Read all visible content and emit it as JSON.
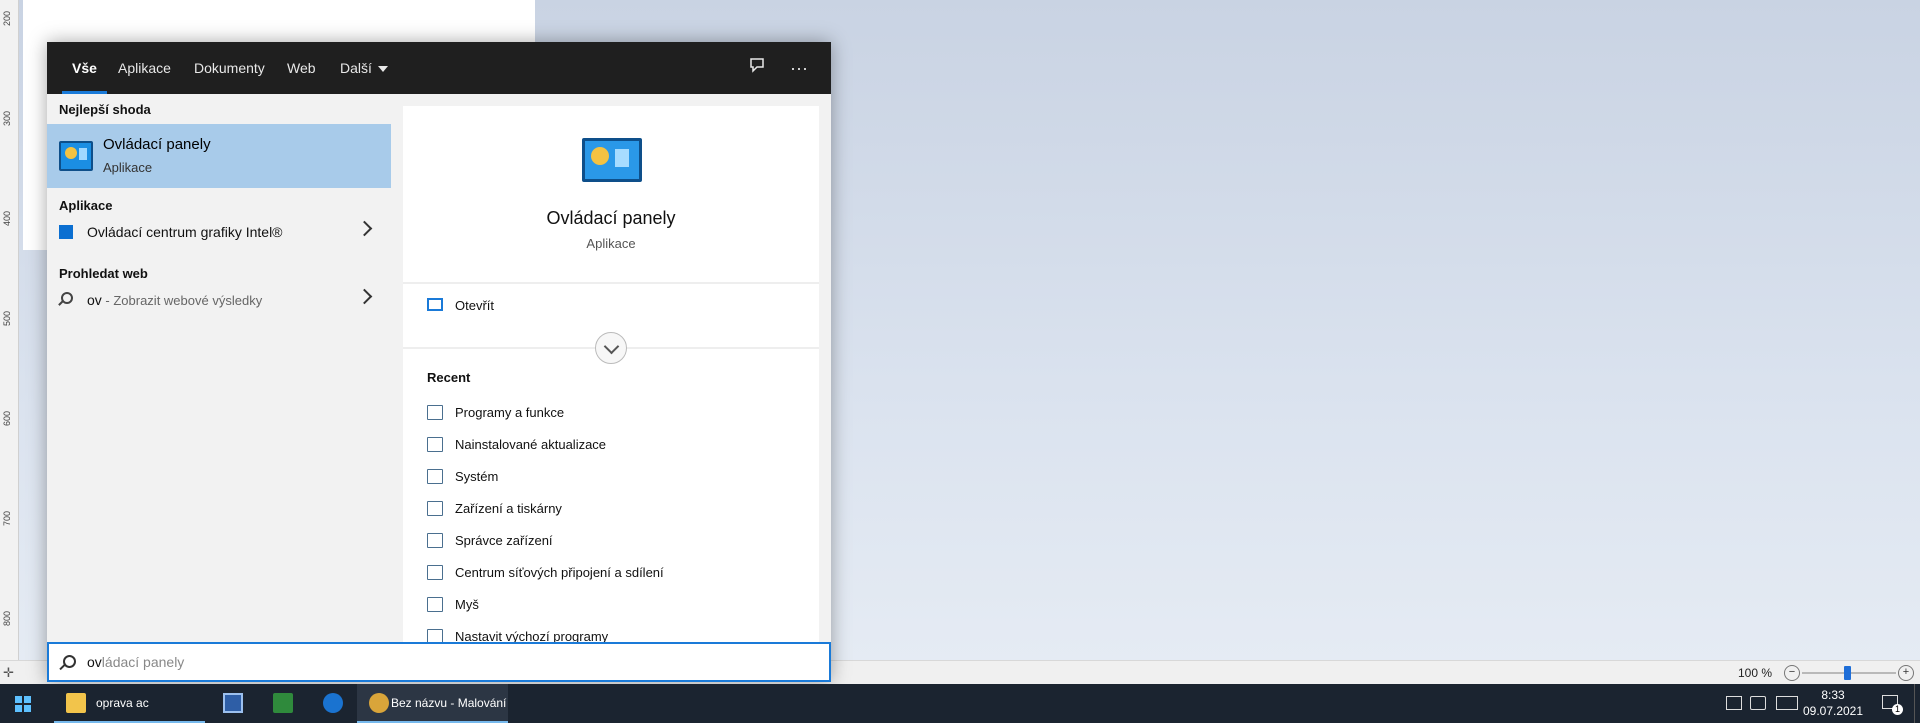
{
  "paint": {
    "ruler_ticks": [
      "200",
      "300",
      "400",
      "500",
      "600",
      "700",
      "800"
    ],
    "zoom_label": "100 %",
    "zoom_out": "−",
    "zoom_in": "+"
  },
  "search_menu": {
    "tabs": [
      "Vše",
      "Aplikace",
      "Dokumenty",
      "Web",
      "Další"
    ],
    "more_icon": "···",
    "feedback_icon": "feedback-icon",
    "best_match_label": "Nejlepší shoda",
    "best_match": {
      "title": "Ovládací panely",
      "subtitle": "Aplikace"
    },
    "apps_label": "Aplikace",
    "apps": [
      {
        "title": "Ovládací centrum grafiky Intel®"
      }
    ],
    "web_label": "Prohledat web",
    "web": {
      "query": "ov",
      "hint": " - Zobrazit webové výsledky"
    },
    "detail": {
      "title": "Ovládací panely",
      "subtitle": "Aplikace",
      "open_label": "Otevřít",
      "recent_label": "Recent",
      "recent": [
        "Programy a funkce",
        "Nainstalované aktualizace",
        "Systém",
        "Zařízení a tiskárny",
        "Správce zařízení",
        "Centrum síťových připojení a sdílení",
        "Myš",
        "Nastavit výchozí programy"
      ]
    },
    "search_box": {
      "typed": "ov",
      "completion": "ládací panely"
    }
  },
  "taskbar": {
    "items": [
      {
        "label": "oprava ac",
        "icon": "folder-icon"
      },
      {
        "label": "",
        "icon": "floppy-icon"
      },
      {
        "label": "",
        "icon": "spreadsheet-icon"
      },
      {
        "label": "",
        "icon": "mail-icon"
      },
      {
        "label": "Bez názvu - Malování",
        "icon": "paint-icon"
      }
    ],
    "clock": {
      "time": "8:33",
      "date": "09.07.2021"
    },
    "notification_count": "1"
  }
}
